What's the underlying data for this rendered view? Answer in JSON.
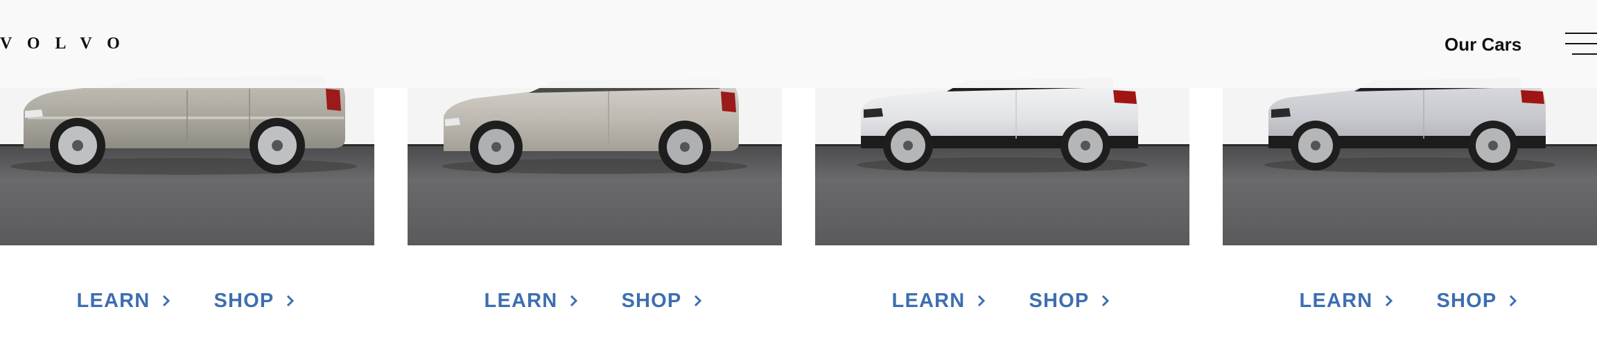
{
  "header": {
    "logo_text": "VOLVO",
    "nav_our_cars": "Our Cars",
    "menu_icon": "hamburger-menu-icon"
  },
  "cars": [
    {
      "learn_label": "LEARN",
      "shop_label": "SHOP",
      "body_color": "#a8a59c",
      "style": "large-suv"
    },
    {
      "learn_label": "LEARN",
      "shop_label": "SHOP",
      "body_color": "#bdb9b1",
      "style": "mid-suv"
    },
    {
      "learn_label": "LEARN",
      "shop_label": "SHOP",
      "body_color": "#e6e7e9",
      "style": "compact-suv"
    },
    {
      "learn_label": "LEARN",
      "shop_label": "SHOP",
      "body_color": "#c6c8cd",
      "style": "compact-suv"
    }
  ],
  "colors": {
    "link_blue": "#3d6eb0",
    "header_bg": "#f9f9fa",
    "floor_dark": "#5e5e60",
    "wall": "#f3f3f3"
  },
  "icons": {
    "chevron": "chevron-right-icon"
  }
}
